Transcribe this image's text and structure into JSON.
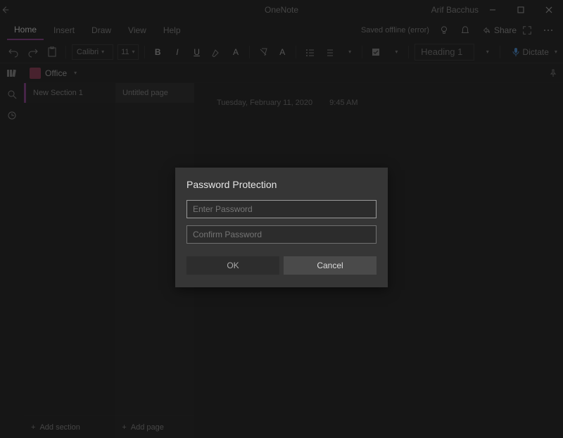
{
  "titlebar": {
    "app_title": "OneNote",
    "user_name": "Arif Bacchus"
  },
  "menu": {
    "tabs": [
      "Home",
      "Insert",
      "Draw",
      "View",
      "Help"
    ],
    "active_index": 0,
    "saved_status": "Saved offline (error)",
    "share_label": "Share"
  },
  "ribbon": {
    "font_name": "Calibri",
    "font_size": "11",
    "style_name": "Heading 1",
    "dictate_label": "Dictate"
  },
  "notebook": {
    "name": "Office",
    "section": "New Section 1",
    "page": "Untitled page",
    "add_section": "Add section",
    "add_page": "Add page"
  },
  "canvas": {
    "date": "Tuesday, February 11, 2020",
    "time": "9:45 AM"
  },
  "modal": {
    "title": "Password Protection",
    "placeholder_enter": "Enter Password",
    "placeholder_confirm": "Confirm Password",
    "ok": "OK",
    "cancel": "Cancel"
  }
}
